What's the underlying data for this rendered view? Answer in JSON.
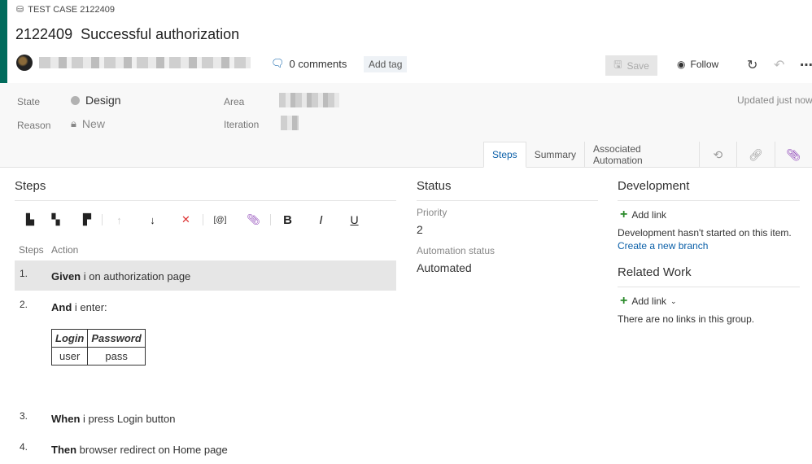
{
  "workitem": {
    "type_label": "TEST CASE 2122409",
    "id": "2122409",
    "title": "Successful authorization",
    "comments": "0 comments",
    "add_tag": "Add tag",
    "save": "Save",
    "follow": "Follow",
    "accent_color": "#006b5c"
  },
  "fields": {
    "state_label": "State",
    "state_value": "Design",
    "reason_label": "Reason",
    "reason_value": "New",
    "area_label": "Area",
    "iteration_label": "Iteration",
    "updated": "Updated just now"
  },
  "tabs": {
    "steps": "Steps",
    "summary": "Summary",
    "automation": "Associated Automation"
  },
  "steps_section": {
    "title": "Steps",
    "col_steps": "Steps",
    "col_action": "Action",
    "toolbar": {
      "bold": "B",
      "italic": "I",
      "underline": "U",
      "param": "[@]"
    },
    "items": [
      {
        "num": "1.",
        "keyword": "Given",
        "text": " i on authorization page"
      },
      {
        "num": "2.",
        "keyword": "And",
        "text": " i enter:"
      },
      {
        "num": "3.",
        "keyword": "When",
        "text": " i press Login button"
      },
      {
        "num": "4.",
        "keyword": "Then",
        "text": " browser redirect on Home page"
      }
    ],
    "param_table": {
      "headers": [
        "Login",
        "Password"
      ],
      "rows": [
        [
          "user",
          "pass"
        ]
      ]
    }
  },
  "status": {
    "title": "Status",
    "priority_label": "Priority",
    "priority_value": "2",
    "automation_label": "Automation status",
    "automation_value": "Automated"
  },
  "development": {
    "title": "Development",
    "add_link": "Add link",
    "text": "Development hasn't started on this item.",
    "create_branch": "Create a new branch"
  },
  "related": {
    "title": "Related Work",
    "add_link": "Add link",
    "text": "There are no links in this group."
  }
}
